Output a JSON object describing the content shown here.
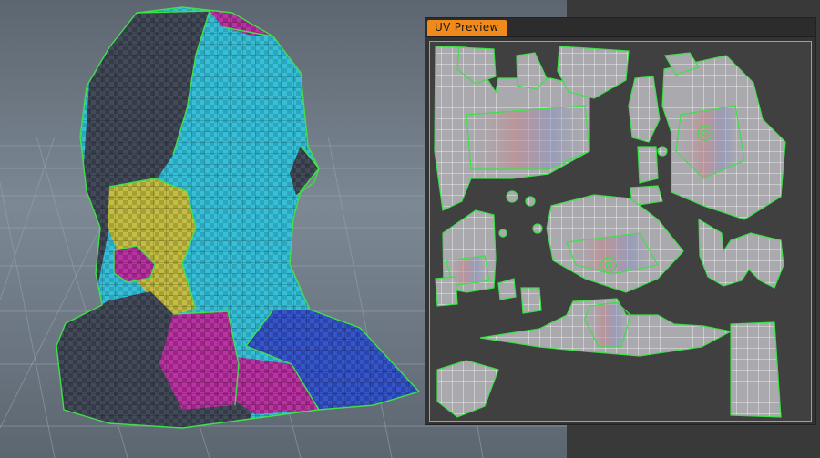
{
  "uv_panel": {
    "tab_label": "UV Preview"
  },
  "viewport": {
    "icons": [
      "head-mesh-icon",
      "grid-floor-icon"
    ]
  },
  "colors": {
    "viewport_bg": "#7e8a97",
    "uv_tab": "#f08a1c",
    "uv_border": "#b7a92b",
    "seam": "#3fe04a",
    "mesh_cyan": "#2fb0c8",
    "mesh_yellow": "#b7b038",
    "mesh_magenta": "#b02a9a",
    "mesh_blue": "#2d49b8",
    "mesh_dark": "#3b4150"
  }
}
